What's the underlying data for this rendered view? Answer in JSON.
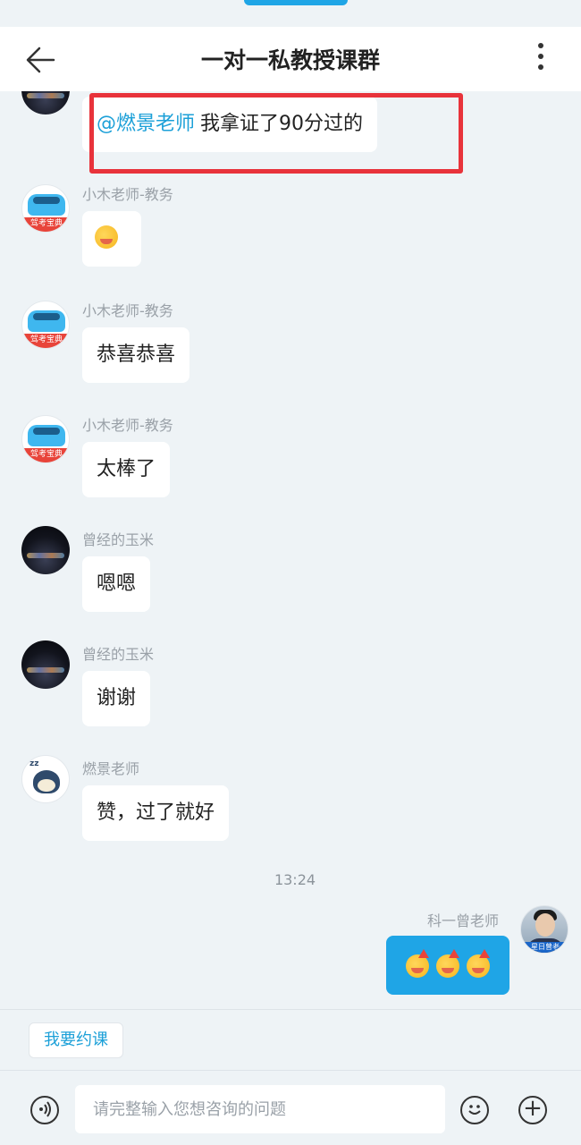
{
  "header": {
    "title": "一对一私教授课群",
    "back_icon": "arrow-left-icon",
    "more_icon": "more-vertical-icon"
  },
  "messages": [
    {
      "sender": "",
      "text": "我拿证了90分过的",
      "mention": "@燃景老师",
      "highlighted": true
    },
    {
      "sender": "小木老师-教务",
      "text": "",
      "emoji": "laughing-emoji"
    },
    {
      "sender": "小木老师-教务",
      "text": "恭喜恭喜"
    },
    {
      "sender": "小木老师-教务",
      "text": "太棒了"
    },
    {
      "sender": "曾经的玉米",
      "text": "嗯嗯"
    },
    {
      "sender": "曾经的玉米",
      "text": "谢谢"
    },
    {
      "sender": "燃景老师",
      "text": "赞，过了就好"
    }
  ],
  "timestamp": "13:24",
  "outgoing": {
    "sender": "科一曾老师",
    "emojis": [
      "party-emoji",
      "party-emoji",
      "party-emoji"
    ],
    "accent": "#1fa5e6"
  },
  "avatar_labels": {
    "car_band": "驾考宝典",
    "person_tag": "星日曾老"
  },
  "quick_actions": {
    "book_lesson": "我要约课"
  },
  "input": {
    "placeholder": "请完整输入您想咨询的问题",
    "value": ""
  },
  "colors": {
    "accent": "#1fa5e6",
    "mention": "#1ca0d8",
    "highlight_border": "#e8333b",
    "background": "#eef3f6"
  }
}
